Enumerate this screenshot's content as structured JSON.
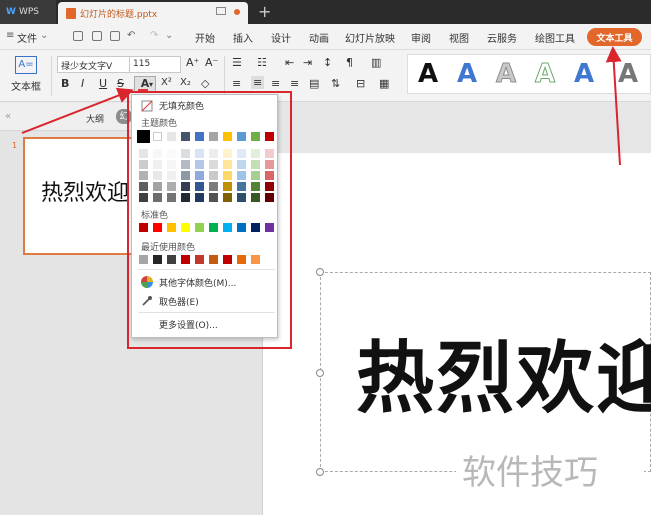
{
  "titlebar": {
    "app": "WPS",
    "doc_name": "幻灯片的标题.pptx"
  },
  "menu": {
    "file": "文件",
    "tabs": [
      "开始",
      "插入",
      "设计",
      "动画",
      "幻灯片放映",
      "审阅",
      "视图",
      "云服务",
      "绘图工具"
    ],
    "active": "文本工具"
  },
  "ribbon": {
    "textbox_label": "文本框",
    "font_name": "禄少女文字V",
    "font_size": "115",
    "format_buttons": [
      "B",
      "I",
      "U",
      "S",
      "A",
      "X²",
      "X₂",
      "◇"
    ],
    "style_letters": [
      "A",
      "A",
      "A",
      "A",
      "A",
      "A"
    ]
  },
  "pane": {
    "tab_outline": "大纲",
    "tab_slides": "幻",
    "slide_number": "1",
    "thumb_text": "热烈欢迎"
  },
  "slide": {
    "big_text": "热烈欢迎"
  },
  "popup": {
    "no_fill": "无填充颜色",
    "theme_colors": "主题颜色",
    "standard_colors": "标准色",
    "recent_colors": "最近使用颜色",
    "more_colors": "其他字体颜色(M)...",
    "eyedropper": "取色器(E)",
    "more_settings": "更多设置(O)..."
  },
  "watermark": "软件技巧",
  "colors": {
    "accent": "#e2672a",
    "annotation": "#d9262e",
    "theme_top": [
      "#000000",
      "#ffffff",
      "#e7e6e6",
      "#44546a",
      "#4472c4",
      "#a5a5a5",
      "#ffc000",
      "#5b9bd5",
      "#70ad47",
      "#c00000"
    ],
    "standard": [
      "#c00000",
      "#ff0000",
      "#ffc000",
      "#ffff00",
      "#92d050",
      "#00b050",
      "#00b0f0",
      "#0070c0",
      "#002060",
      "#7030a0"
    ],
    "recent": [
      "#a6a6a6",
      "#262626",
      "#404040",
      "#c00000",
      "#c0392b",
      "#c55a11",
      "#c00000",
      "#e36c09",
      "#f79646"
    ]
  }
}
